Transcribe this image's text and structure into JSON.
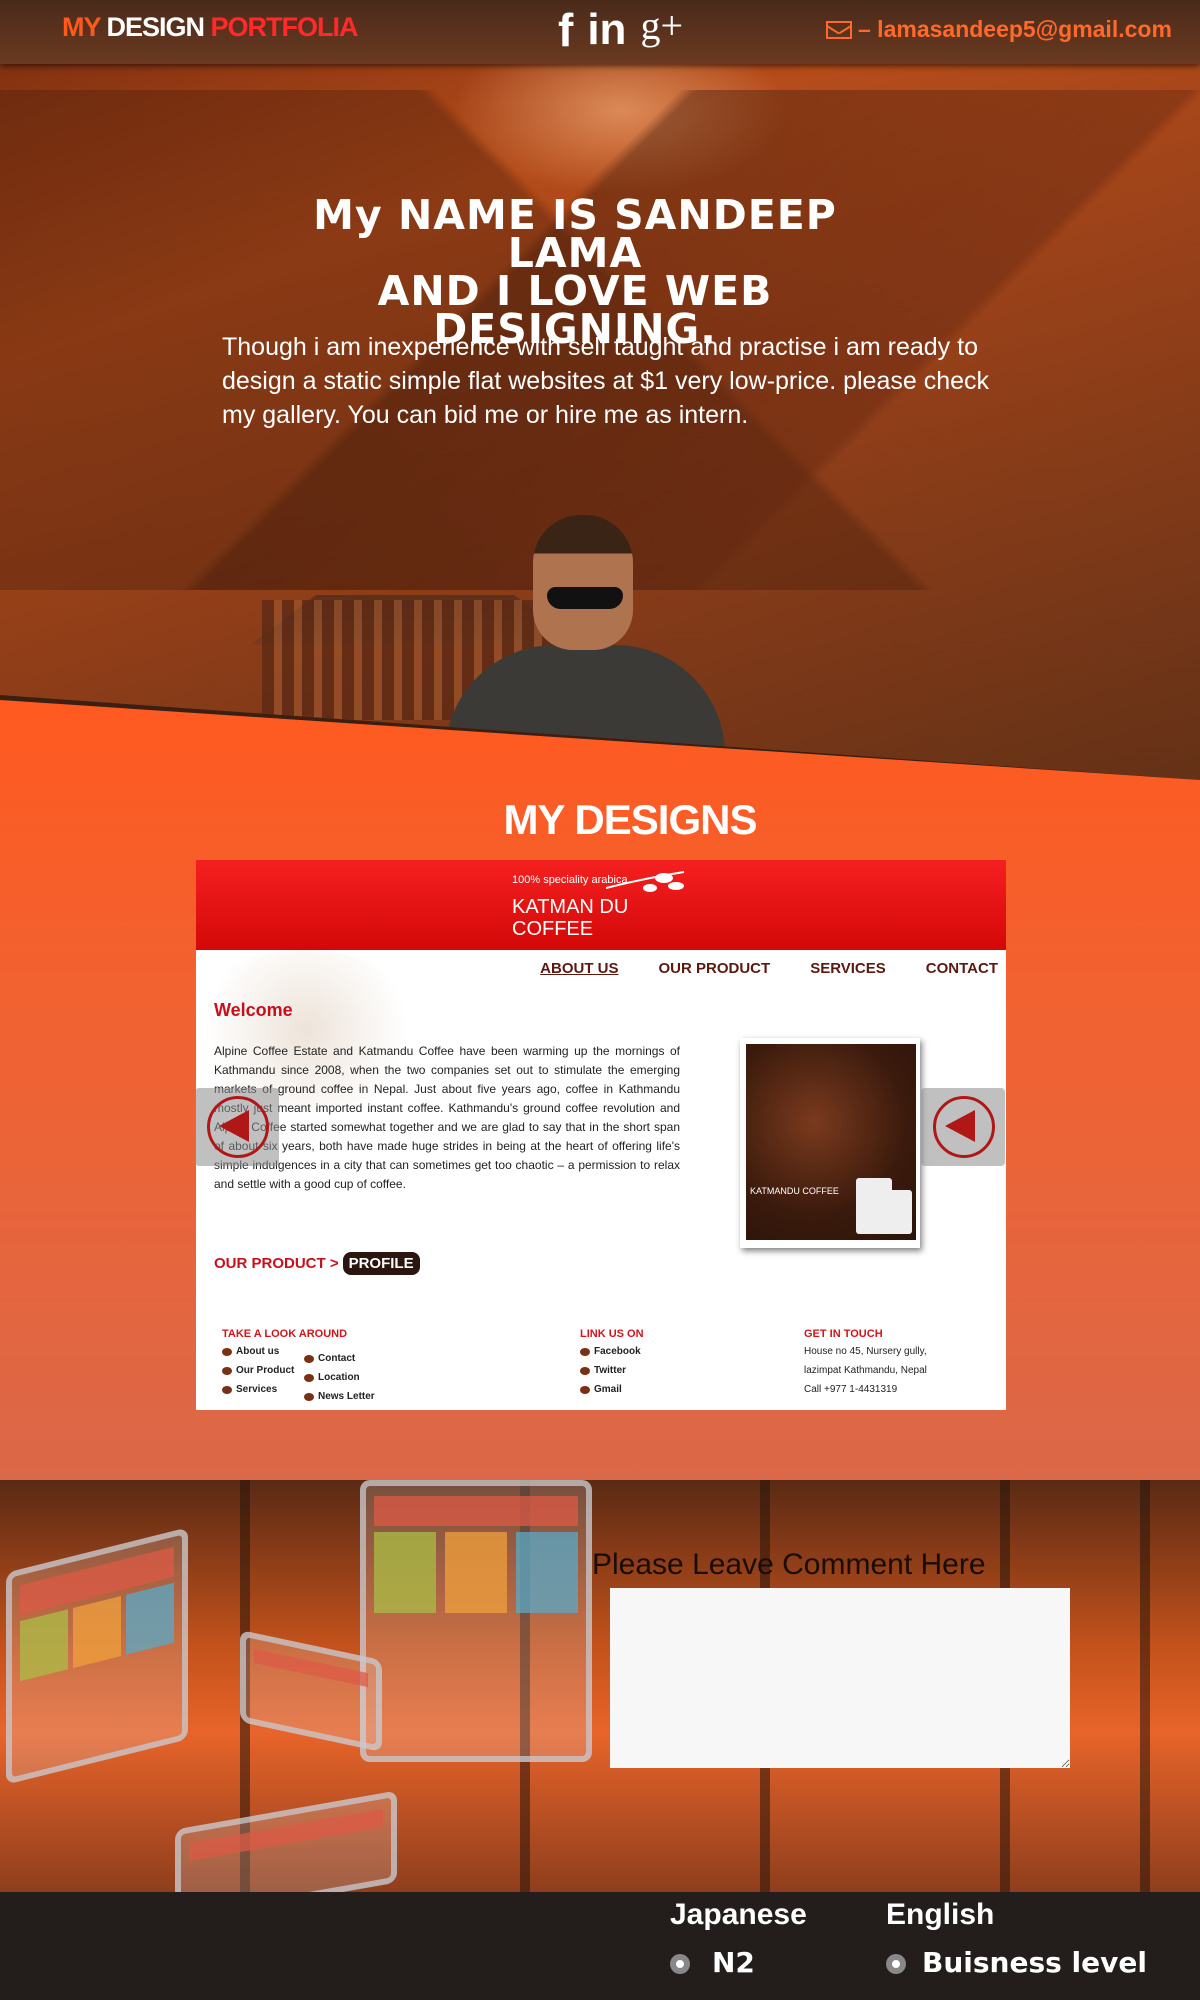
{
  "header": {
    "logo": {
      "part1": "MY ",
      "part2": "DESIGN ",
      "part3": "PORTFOLIA"
    },
    "social": [
      "f",
      "in",
      "g+"
    ],
    "email": "– lamasandeep5@gmail.com"
  },
  "hero": {
    "headline_line1": "My NAME IS SANDEEP LAMA",
    "headline_line2": "AND I LOVE WEB DESIGNING.",
    "intro": "Though i am inexperience with self taught and practise i am ready to design  a static simple flat websites at $1 very low-price. please check my gallery. You can bid me or hire me as intern."
  },
  "designs": {
    "title": "MY DESIGNS",
    "slide": {
      "tagline": "100% speciality arabica",
      "brand_line1": "KATMAN DU",
      "brand_line2": "COFFEE",
      "nav": [
        "ABOUT US",
        "OUR PRODUCT",
        "SERVICES",
        "CONTACT"
      ],
      "welcome": "Welcome",
      "body": "Alpine Coffee Estate and Katmandu Coffee have been warming up the mornings of Kathmandu since 2008, when the two companies set out to stimulate the emerging markets of ground coffee in Nepal. Just about five years ago, coffee in Kathmandu mostly just meant imported instant coffee. Kathmandu's ground coffee revolution and Alpine Coffee started somewhat together and we are glad to say that in the short span of about six years, both have made huge strides in being at the heart of offering life's simple indulgences in a city that can sometimes get too chaotic – a permission to relax and settle with a good cup of coffee.",
      "photo_caption": "KATMANDU COFFEE",
      "product_link": "OUR PRODUCT >",
      "profile_button": "PROFILE",
      "footer": {
        "col1_title": "TAKE A LOOK AROUND",
        "col1_items": [
          "About us",
          "Our Product",
          "Services"
        ],
        "col1b_items": [
          "Contact",
          "Location",
          "News Letter"
        ],
        "col2_title": "LINK US ON",
        "col2_items": [
          "Facebook",
          "Twitter",
          "Gmail"
        ],
        "col3_title": "GET IN TOUCH",
        "col3_items": [
          "House no 45, Nursery gully,",
          "lazimpat  Kathmandu, Nepal",
          "Call +977 1-4431319"
        ]
      }
    }
  },
  "comment": {
    "label": "Please Leave Comment Here",
    "value": ""
  },
  "languages": [
    {
      "name": "Japanese",
      "level": "N2"
    },
    {
      "name": "English",
      "level": "Buisness level"
    }
  ],
  "colors": {
    "accent": "#ff5a1a",
    "brand_red": "#e8121a",
    "bar_dark": "#231e1c"
  }
}
